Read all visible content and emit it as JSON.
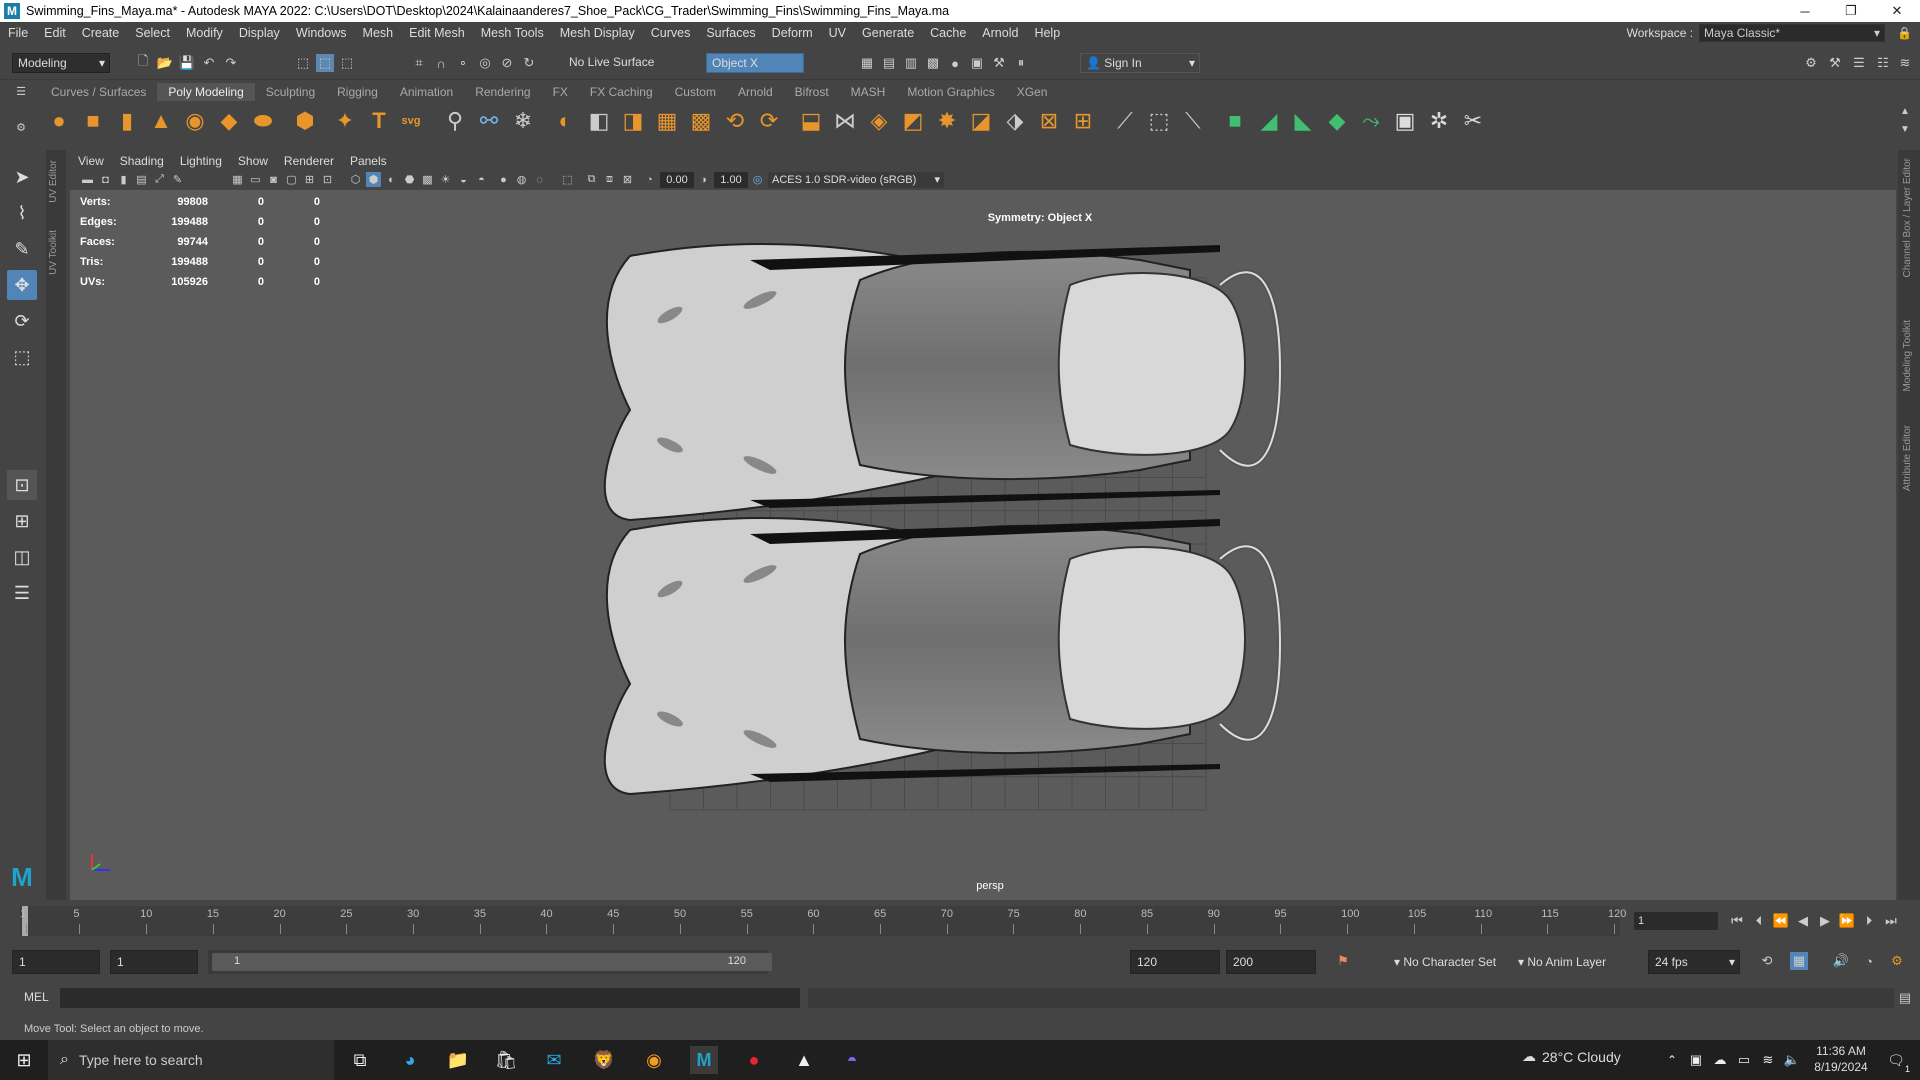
{
  "window": {
    "title": "Swimming_Fins_Maya.ma* - Autodesk MAYA 2022: C:\\Users\\DOT\\Desktop\\2024\\Kalainaanderes7_Shoe_Pack\\CG_Trader\\Swimming_Fins\\Swimming_Fins_Maya.ma",
    "minimize": "─",
    "restore": "❐",
    "close": "✕"
  },
  "menu": [
    "File",
    "Edit",
    "Create",
    "Select",
    "Modify",
    "Display",
    "Windows",
    "Mesh",
    "Edit Mesh",
    "Mesh Tools",
    "Mesh Display",
    "Curves",
    "Surfaces",
    "Deform",
    "UV",
    "Generate",
    "Cache",
    "Arnold",
    "Help"
  ],
  "workspace": {
    "label": "Workspace :",
    "value": "Maya Classic*"
  },
  "status": {
    "mode": "Modeling",
    "live_surface": "No Live Surface",
    "symmetry": "Object X",
    "sign_in": "Sign In"
  },
  "shelf_tabs": [
    "Curves / Surfaces",
    "Poly Modeling",
    "Sculpting",
    "Rigging",
    "Animation",
    "Rendering",
    "FX",
    "FX Caching",
    "Custom",
    "Arnold",
    "Bifrost",
    "MASH",
    "Motion Graphics",
    "XGen"
  ],
  "shelf_active": "Poly Modeling",
  "panel_menu": [
    "View",
    "Shading",
    "Lighting",
    "Show",
    "Renderer",
    "Panels"
  ],
  "panel_toolbar": {
    "exposure": "0.00",
    "gamma": "1.00",
    "colorspace": "ACES 1.0 SDR-video (sRGB)"
  },
  "hud": [
    {
      "label": "Verts:",
      "v1": "99808",
      "v2": "0",
      "v3": "0"
    },
    {
      "label": "Edges:",
      "v1": "199488",
      "v2": "0",
      "v3": "0"
    },
    {
      "label": "Faces:",
      "v1": "99744",
      "v2": "0",
      "v3": "0"
    },
    {
      "label": "Tris:",
      "v1": "199488",
      "v2": "0",
      "v3": "0"
    },
    {
      "label": "UVs:",
      "v1": "105926",
      "v2": "0",
      "v3": "0"
    }
  ],
  "viewport": {
    "symmetry_label": "Symmetry: Object X",
    "camera": "persp"
  },
  "left_tabs": [
    "UV Editor",
    "UV Toolkit"
  ],
  "right_tabs": [
    "Channel Box / Layer Editor",
    "Modeling Toolkit",
    "Attribute Editor"
  ],
  "timeline": {
    "ticks": [
      "1",
      "5",
      "10",
      "15",
      "20",
      "25",
      "30",
      "35",
      "40",
      "45",
      "50",
      "55",
      "60",
      "65",
      "70",
      "75",
      "80",
      "85",
      "90",
      "95",
      "100",
      "105",
      "110",
      "115",
      "120"
    ],
    "current_frame": "1"
  },
  "range": {
    "start": "1",
    "playback_start": "1",
    "slider_start": "1",
    "slider_end": "120",
    "playback_end": "120",
    "end": "200",
    "character_set": "No Character Set",
    "anim_layer": "No Anim Layer",
    "fps": "24 fps"
  },
  "mel": {
    "label": "MEL"
  },
  "help_line": "Move Tool: Select an object to move.",
  "taskbar": {
    "search_placeholder": "Type here to search",
    "weather": "28°C  Cloudy",
    "time": "11:36 AM",
    "date": "8/19/2024",
    "notif": "1"
  }
}
